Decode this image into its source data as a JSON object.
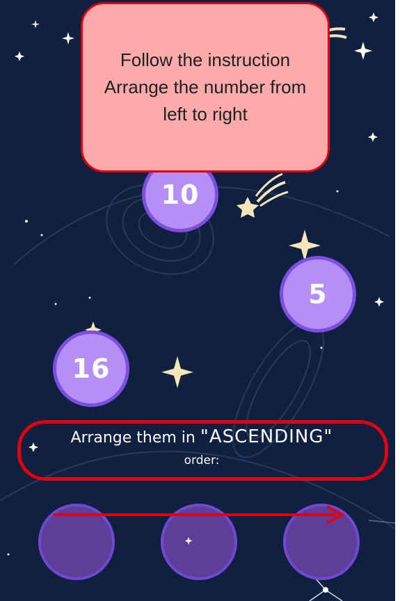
{
  "popup": {
    "line1": "Follow the instruction",
    "line2": "Arrange the number from",
    "line3": "left to right"
  },
  "bubbles": [
    {
      "label": "10"
    },
    {
      "label": "5"
    },
    {
      "label": "16"
    }
  ],
  "instruction": {
    "prefix": "Arrange them in ",
    "emphasis": "\"ASCENDING\"",
    "suffix": "order:"
  },
  "slots_count": 3,
  "colors": {
    "background": "#0f2040",
    "bubble_fill": "#b48ff4",
    "bubble_border": "#7d4fe0",
    "slot_fill": "#5d3f9a",
    "popup_fill": "#fdaaaa",
    "highlight_red": "#e0000f",
    "star": "#f4e6b8"
  },
  "icons": {
    "decoration": [
      "shooting-star-icon",
      "sparkle-icon",
      "planet-icon",
      "constellation-icon"
    ],
    "annotation": "arrow-right-icon"
  }
}
